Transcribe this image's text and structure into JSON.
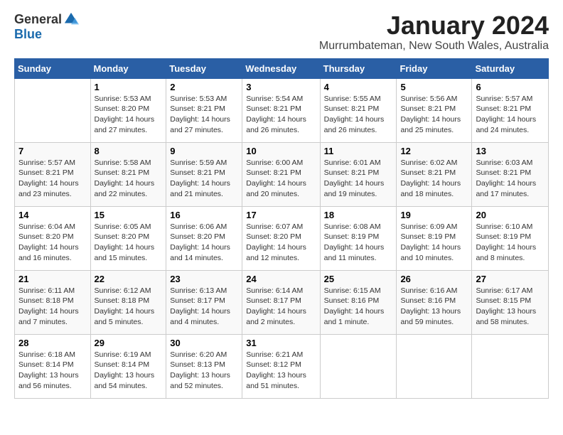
{
  "logo": {
    "general": "General",
    "blue": "Blue"
  },
  "title": "January 2024",
  "subtitle": "Murrumbateman, New South Wales, Australia",
  "days_of_week": [
    "Sunday",
    "Monday",
    "Tuesday",
    "Wednesday",
    "Thursday",
    "Friday",
    "Saturday"
  ],
  "weeks": [
    [
      {
        "day": "",
        "info": ""
      },
      {
        "day": "1",
        "info": "Sunrise: 5:53 AM\nSunset: 8:20 PM\nDaylight: 14 hours\nand 27 minutes."
      },
      {
        "day": "2",
        "info": "Sunrise: 5:53 AM\nSunset: 8:21 PM\nDaylight: 14 hours\nand 27 minutes."
      },
      {
        "day": "3",
        "info": "Sunrise: 5:54 AM\nSunset: 8:21 PM\nDaylight: 14 hours\nand 26 minutes."
      },
      {
        "day": "4",
        "info": "Sunrise: 5:55 AM\nSunset: 8:21 PM\nDaylight: 14 hours\nand 26 minutes."
      },
      {
        "day": "5",
        "info": "Sunrise: 5:56 AM\nSunset: 8:21 PM\nDaylight: 14 hours\nand 25 minutes."
      },
      {
        "day": "6",
        "info": "Sunrise: 5:57 AM\nSunset: 8:21 PM\nDaylight: 14 hours\nand 24 minutes."
      }
    ],
    [
      {
        "day": "7",
        "info": "Sunrise: 5:57 AM\nSunset: 8:21 PM\nDaylight: 14 hours\nand 23 minutes."
      },
      {
        "day": "8",
        "info": "Sunrise: 5:58 AM\nSunset: 8:21 PM\nDaylight: 14 hours\nand 22 minutes."
      },
      {
        "day": "9",
        "info": "Sunrise: 5:59 AM\nSunset: 8:21 PM\nDaylight: 14 hours\nand 21 minutes."
      },
      {
        "day": "10",
        "info": "Sunrise: 6:00 AM\nSunset: 8:21 PM\nDaylight: 14 hours\nand 20 minutes."
      },
      {
        "day": "11",
        "info": "Sunrise: 6:01 AM\nSunset: 8:21 PM\nDaylight: 14 hours\nand 19 minutes."
      },
      {
        "day": "12",
        "info": "Sunrise: 6:02 AM\nSunset: 8:21 PM\nDaylight: 14 hours\nand 18 minutes."
      },
      {
        "day": "13",
        "info": "Sunrise: 6:03 AM\nSunset: 8:21 PM\nDaylight: 14 hours\nand 17 minutes."
      }
    ],
    [
      {
        "day": "14",
        "info": "Sunrise: 6:04 AM\nSunset: 8:20 PM\nDaylight: 14 hours\nand 16 minutes."
      },
      {
        "day": "15",
        "info": "Sunrise: 6:05 AM\nSunset: 8:20 PM\nDaylight: 14 hours\nand 15 minutes."
      },
      {
        "day": "16",
        "info": "Sunrise: 6:06 AM\nSunset: 8:20 PM\nDaylight: 14 hours\nand 14 minutes."
      },
      {
        "day": "17",
        "info": "Sunrise: 6:07 AM\nSunset: 8:20 PM\nDaylight: 14 hours\nand 12 minutes."
      },
      {
        "day": "18",
        "info": "Sunrise: 6:08 AM\nSunset: 8:19 PM\nDaylight: 14 hours\nand 11 minutes."
      },
      {
        "day": "19",
        "info": "Sunrise: 6:09 AM\nSunset: 8:19 PM\nDaylight: 14 hours\nand 10 minutes."
      },
      {
        "day": "20",
        "info": "Sunrise: 6:10 AM\nSunset: 8:19 PM\nDaylight: 14 hours\nand 8 minutes."
      }
    ],
    [
      {
        "day": "21",
        "info": "Sunrise: 6:11 AM\nSunset: 8:18 PM\nDaylight: 14 hours\nand 7 minutes."
      },
      {
        "day": "22",
        "info": "Sunrise: 6:12 AM\nSunset: 8:18 PM\nDaylight: 14 hours\nand 5 minutes."
      },
      {
        "day": "23",
        "info": "Sunrise: 6:13 AM\nSunset: 8:17 PM\nDaylight: 14 hours\nand 4 minutes."
      },
      {
        "day": "24",
        "info": "Sunrise: 6:14 AM\nSunset: 8:17 PM\nDaylight: 14 hours\nand 2 minutes."
      },
      {
        "day": "25",
        "info": "Sunrise: 6:15 AM\nSunset: 8:16 PM\nDaylight: 14 hours\nand 1 minute."
      },
      {
        "day": "26",
        "info": "Sunrise: 6:16 AM\nSunset: 8:16 PM\nDaylight: 13 hours\nand 59 minutes."
      },
      {
        "day": "27",
        "info": "Sunrise: 6:17 AM\nSunset: 8:15 PM\nDaylight: 13 hours\nand 58 minutes."
      }
    ],
    [
      {
        "day": "28",
        "info": "Sunrise: 6:18 AM\nSunset: 8:14 PM\nDaylight: 13 hours\nand 56 minutes."
      },
      {
        "day": "29",
        "info": "Sunrise: 6:19 AM\nSunset: 8:14 PM\nDaylight: 13 hours\nand 54 minutes."
      },
      {
        "day": "30",
        "info": "Sunrise: 6:20 AM\nSunset: 8:13 PM\nDaylight: 13 hours\nand 52 minutes."
      },
      {
        "day": "31",
        "info": "Sunrise: 6:21 AM\nSunset: 8:12 PM\nDaylight: 13 hours\nand 51 minutes."
      },
      {
        "day": "",
        "info": ""
      },
      {
        "day": "",
        "info": ""
      },
      {
        "day": "",
        "info": ""
      }
    ]
  ]
}
